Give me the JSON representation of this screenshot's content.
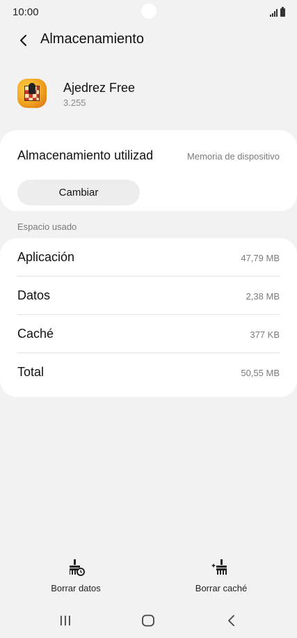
{
  "status_bar": {
    "time": "10:00"
  },
  "header": {
    "title": "Almacenamiento",
    "back_icon": "chevron-left-icon"
  },
  "app": {
    "name": "Ajedrez Free",
    "version": "3.255",
    "icon": "chess-app-icon"
  },
  "storage": {
    "label": "Almacenamiento utilizad",
    "location": "Memoria de dispositivo",
    "change_button": "Cambiar"
  },
  "usage": {
    "section_label": "Espacio usado",
    "rows": [
      {
        "label": "Aplicación",
        "value": "47,79 MB"
      },
      {
        "label": "Datos",
        "value": "2,38 MB"
      },
      {
        "label": "Caché",
        "value": "377 KB"
      },
      {
        "label": "Total",
        "value": "50,55 MB"
      }
    ]
  },
  "actions": {
    "clear_data": {
      "label": "Borrar datos",
      "icon": "broom-clock-icon"
    },
    "clear_cache": {
      "label": "Borrar caché",
      "icon": "broom-sparkle-icon"
    }
  },
  "nav_bar": {
    "recents_icon": "recents-icon",
    "home_icon": "home-icon",
    "back_icon": "back-icon"
  },
  "colors": {
    "background": "#f2f2f2",
    "card": "#ffffff",
    "button": "#ededed",
    "secondary_text": "#7a7a7a"
  }
}
